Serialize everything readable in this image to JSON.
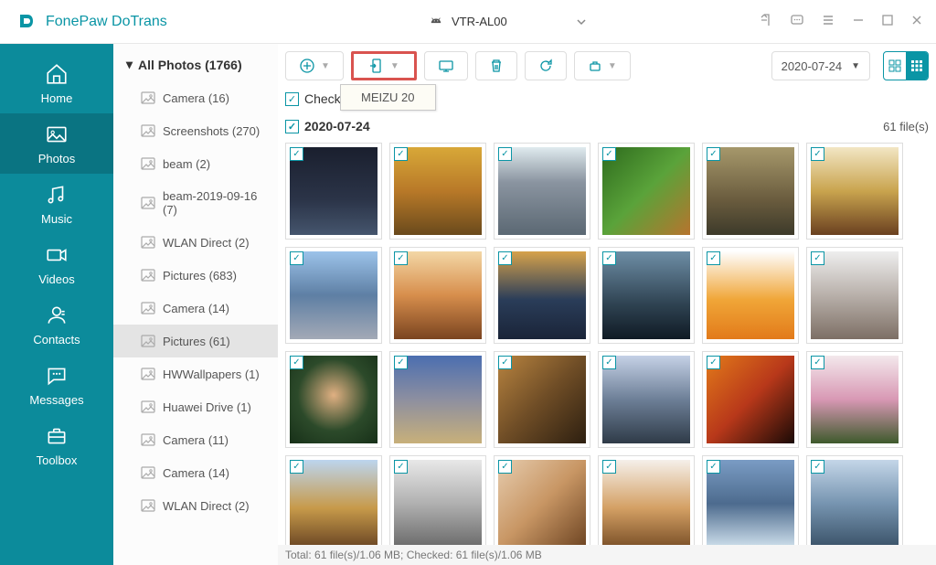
{
  "app_title": "FonePaw DoTrans",
  "device": "VTR-AL00",
  "nav": [
    {
      "label": "Home"
    },
    {
      "label": "Photos"
    },
    {
      "label": "Music"
    },
    {
      "label": "Videos"
    },
    {
      "label": "Contacts"
    },
    {
      "label": "Messages"
    },
    {
      "label": "Toolbox"
    }
  ],
  "all_photos": "All Photos (1766)",
  "folders": [
    {
      "label": "Camera (16)"
    },
    {
      "label": "Screenshots (270)"
    },
    {
      "label": "beam (2)"
    },
    {
      "label": "beam-2019-09-16 (7)"
    },
    {
      "label": "WLAN Direct (2)"
    },
    {
      "label": "Pictures (683)"
    },
    {
      "label": "Camera (14)"
    },
    {
      "label": "Pictures (61)",
      "selected": true
    },
    {
      "label": "HWWallpapers (1)"
    },
    {
      "label": "Huawei Drive (1)"
    },
    {
      "label": "Camera (11)"
    },
    {
      "label": "Camera (14)"
    },
    {
      "label": "WLAN Direct (2)"
    }
  ],
  "tooltip": "MEIZU 20",
  "check_all": "Check All(61)",
  "date_header": "2020-07-24",
  "file_count": "61 file(s)",
  "date_picker": "2020-07-24",
  "status": "Total: 61 file(s)/1.06 MB; Checked: 61 file(s)/1.06 MB",
  "thumbs": [
    {
      "g": "linear-gradient(180deg,#1a1f2e,#2b3448 60%,#45556d)"
    },
    {
      "g": "linear-gradient(180deg,#d8a838,#b87928 50%,#6a4a1c)"
    },
    {
      "g": "linear-gradient(180deg,#dfeaee,#8a94a0 40%,#5b6873)"
    },
    {
      "g": "linear-gradient(135deg,#2e6b1d,#5aa33a 50%,#b7742e)"
    },
    {
      "g": "linear-gradient(180deg,#a6986b,#6a5c3e 60%,#3d3a2a)"
    },
    {
      "g": "linear-gradient(180deg,#f2e6c4,#c9a44e 50%,#6a4020)"
    },
    {
      "g": "linear-gradient(180deg,#9cc3ea,#5e7fa4 50%,#a3a9b6)"
    },
    {
      "g": "linear-gradient(180deg,#f3d7a6,#d78e4c 50%,#7a4420)"
    },
    {
      "g": "linear-gradient(180deg,#d6a24b,#2a3d59 55%,#1a2438)"
    },
    {
      "g": "linear-gradient(180deg,#6e8ea6,#2f4352 60%,#0f1a24)"
    },
    {
      "g": "linear-gradient(180deg,#fefefe,#f0a638 55%,#e27a1a)"
    },
    {
      "g": "linear-gradient(180deg,#eeeeee,#b8b0aa 50%,#7d6f65)"
    },
    {
      "g": "radial-gradient(circle at 50% 45%,#e0b082,#2c4a2a 55%,#173018)"
    },
    {
      "g": "linear-gradient(180deg,#4b6eb0,#8d8fa0 50%,#c8b07a)"
    },
    {
      "g": "linear-gradient(135deg,#b88440,#6f4d26 50%,#2d1f10)"
    },
    {
      "g": "linear-gradient(180deg,#c5d1e6,#6d7f97 50%,#2f3b48)"
    },
    {
      "g": "linear-gradient(135deg,#e27a1a,#b8381a 50%,#1a0a06)"
    },
    {
      "g": "linear-gradient(180deg,#f3e8ec,#d898b4 50%,#3e5a2c)"
    },
    {
      "g": "linear-gradient(180deg,#bcd5ee,#c79a4a 55%,#6a4624)"
    },
    {
      "g": "linear-gradient(180deg,#e8e8e8,#b0b0b0 50%,#6a6a6a)"
    },
    {
      "g": "linear-gradient(135deg,#e6ccae,#c89664 50%,#6d4422)"
    },
    {
      "g": "linear-gradient(180deg,#f5f0ea,#d4a064 55%,#7a5028)"
    },
    {
      "g": "linear-gradient(180deg,#7a9cc4,#4d6b8e 50%,#cfe0ec)"
    },
    {
      "g": "linear-gradient(180deg,#c4d6e8,#7694b0 50%,#3a5268)"
    }
  ]
}
